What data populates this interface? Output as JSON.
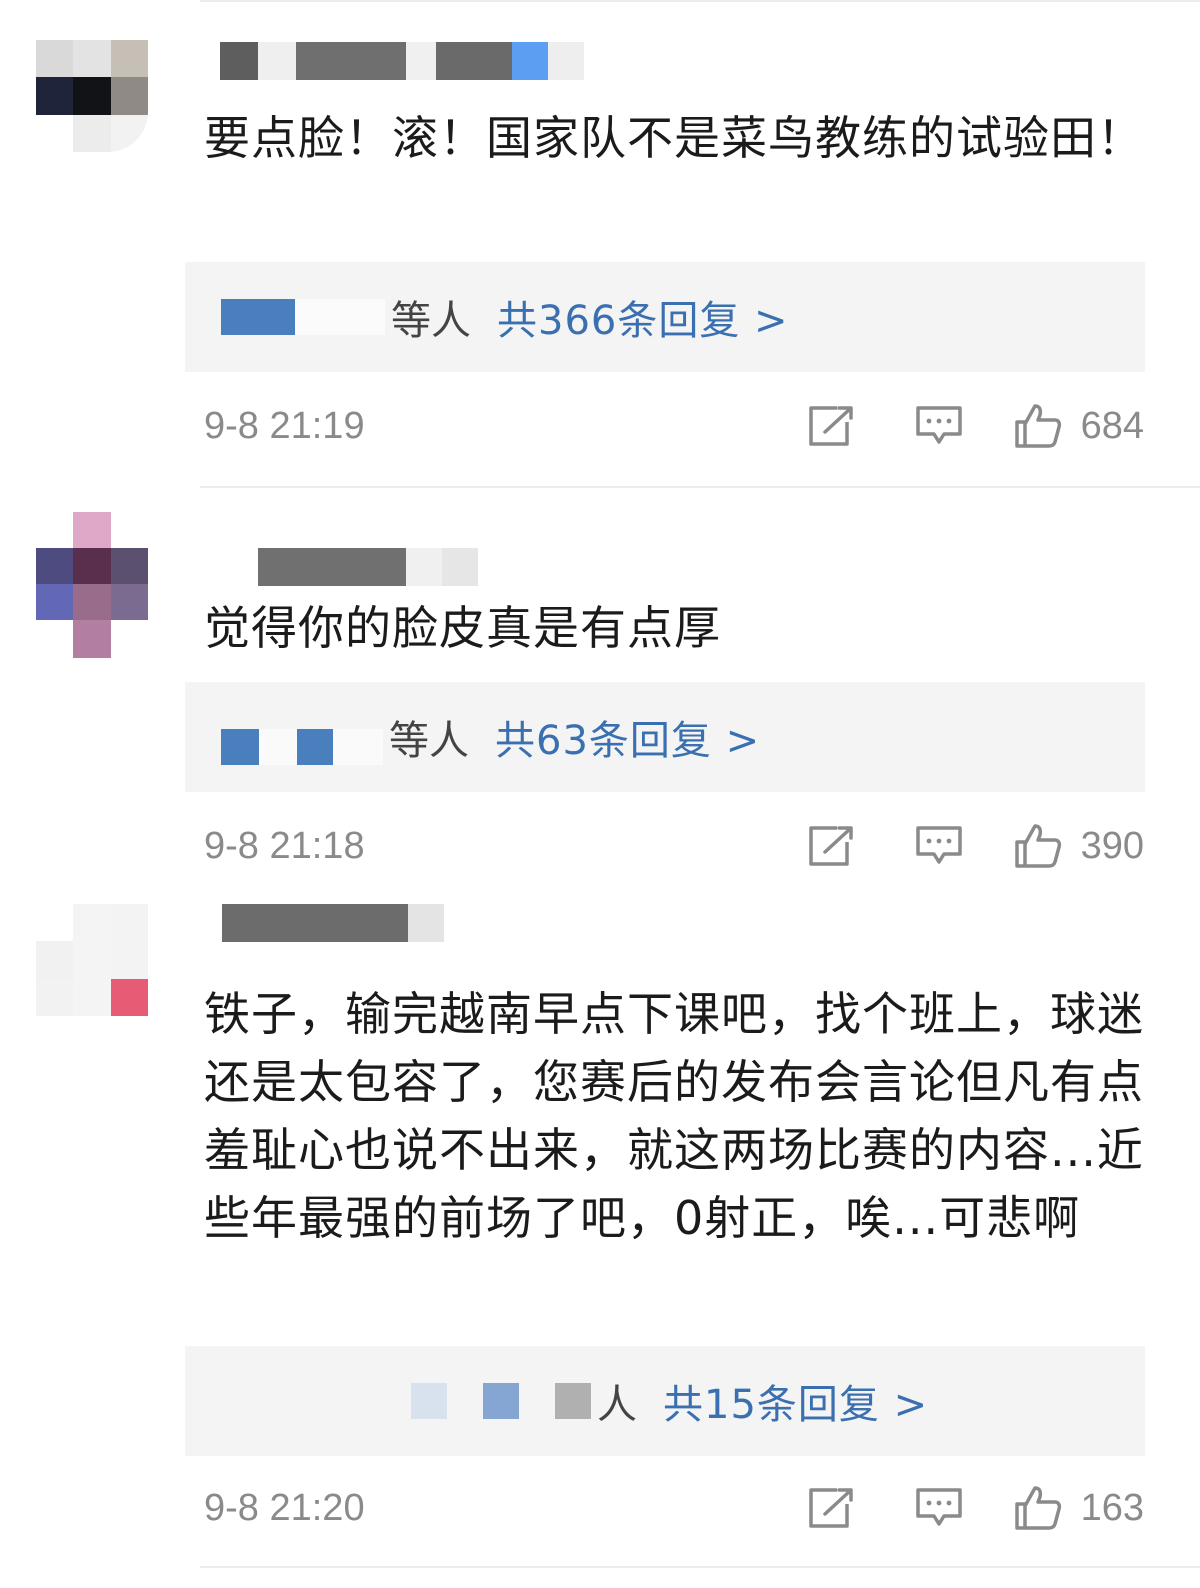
{
  "comments": [
    {
      "text": "要点脸！滚！国家队不是菜鸟教练的试验田！",
      "reply_suffix": "等人",
      "reply_link": "共366条回复 >",
      "time": "9-8 21:19",
      "likes": "684"
    },
    {
      "text": "觉得你的脸皮真是有点厚",
      "reply_suffix": "等人",
      "reply_link": "共63条回复 >",
      "time": "9-8 21:18",
      "likes": "390"
    },
    {
      "text": "铁子，输完越南早点下课吧，找个班上，球迷还是太包容了，您赛后的发布会言论但凡有点羞耻心也说不出来，就这两场比赛的内容...近些年最强的前场了吧，0射正，唉...可悲啊",
      "reply_suffix": "人",
      "reply_link": "共15条回复 >",
      "time": "9-8 21:20",
      "likes": "163"
    }
  ],
  "icons": {
    "share": "share-icon",
    "comment": "comment-icon",
    "like": "thumbs-up-icon"
  },
  "colors": {
    "link": "#3a6fb0",
    "meta": "#8a8a8a",
    "reply_bg": "#f4f4f4"
  }
}
